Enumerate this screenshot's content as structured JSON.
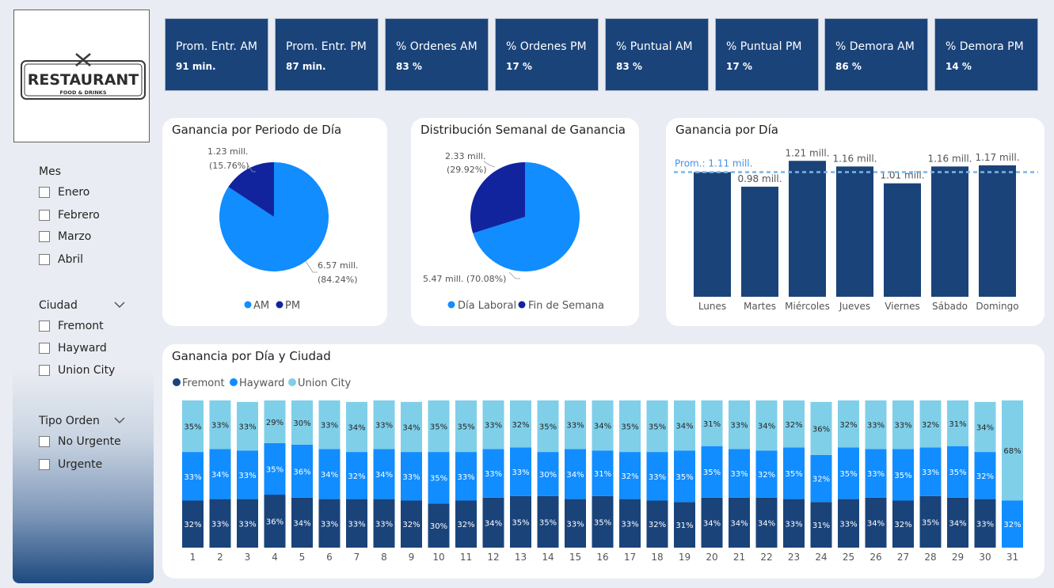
{
  "logo": {
    "name": "RESTAURANT",
    "tagline": "FOOD & DRINKS"
  },
  "slicers": {
    "mes": {
      "title": "Mes",
      "items": [
        "Enero",
        "Febrero",
        "Marzo",
        "Abril"
      ]
    },
    "ciudad": {
      "title": "Ciudad",
      "items": [
        "Fremont",
        "Hayward",
        "Union City"
      ]
    },
    "tipo": {
      "title": "Tipo Orden",
      "items": [
        "No Urgente",
        "Urgente"
      ]
    }
  },
  "kpis": [
    {
      "label": "Prom. Entr. AM",
      "value": "91 min."
    },
    {
      "label": "Prom. Entr. PM",
      "value": "87 min."
    },
    {
      "label": "% Ordenes AM",
      "value": "83 %"
    },
    {
      "label": "% Ordenes PM",
      "value": "17 %"
    },
    {
      "label": "% Puntual AM",
      "value": "83 %"
    },
    {
      "label": "% Puntual PM",
      "value": "17 %"
    },
    {
      "label": "% Demora AM",
      "value": "86 %"
    },
    {
      "label": "% Demora PM",
      "value": "14 %"
    }
  ],
  "colors": {
    "navy": "#1a437a",
    "blue": "#118dff",
    "light": "#7fcfe9",
    "dark_pie": "#12239e",
    "avg_line": "#7ab6e6"
  },
  "chart_data": [
    {
      "type": "pie",
      "title": "Ganancia por Periodo de Día",
      "labels": [
        "AM",
        "PM"
      ],
      "values": [
        6.57,
        1.23
      ],
      "percents": [
        84.24,
        15.76
      ],
      "value_labels": [
        "6.57 mill.",
        "1.23 mill."
      ],
      "percent_labels": [
        "(84.24%)",
        "(15.76%)"
      ],
      "colors": [
        "#118dff",
        "#12239e"
      ]
    },
    {
      "type": "pie",
      "title": "Distribución Semanal de Ganancia",
      "labels": [
        "Día Laboral",
        "Fin de Semana"
      ],
      "values": [
        5.47,
        2.33
      ],
      "percents": [
        70.08,
        29.92
      ],
      "value_labels": [
        "5.47 mill. (70.08%)",
        "2.33 mill."
      ],
      "percent_labels": [
        "",
        "(29.92%)"
      ],
      "colors": [
        "#118dff",
        "#12239e"
      ]
    },
    {
      "type": "bar",
      "title": "Ganancia por Día",
      "categories": [
        "Lunes",
        "Martes",
        "Miércoles",
        "Jueves",
        "Viernes",
        "Sábado",
        "Domingo"
      ],
      "values": [
        1.11,
        0.98,
        1.21,
        1.16,
        1.01,
        1.16,
        1.17
      ],
      "value_labels": [
        "",
        "0.98 mill.",
        "1.21 mill.",
        "1.16 mill.",
        "1.01 mill.",
        "1.16 mill.",
        "1.17 mill."
      ],
      "average": 1.11,
      "average_label": "Prom.: 1.11 mill.",
      "ylim": [
        0,
        1.24
      ]
    },
    {
      "type": "bar",
      "stacked": "percent",
      "title": "Ganancia por Día y Ciudad",
      "categories": [
        "1",
        "2",
        "3",
        "4",
        "5",
        "6",
        "7",
        "8",
        "9",
        "10",
        "11",
        "12",
        "13",
        "14",
        "15",
        "16",
        "17",
        "18",
        "19",
        "20",
        "21",
        "22",
        "23",
        "24",
        "25",
        "26",
        "27",
        "28",
        "29",
        "30",
        "31"
      ],
      "series": [
        {
          "name": "Fremont",
          "color": "#1a437a",
          "values": [
            32,
            33,
            33,
            36,
            34,
            33,
            33,
            33,
            32,
            30,
            32,
            34,
            35,
            35,
            33,
            35,
            33,
            32,
            31,
            34,
            34,
            34,
            33,
            31,
            33,
            34,
            32,
            35,
            34,
            33,
            0
          ]
        },
        {
          "name": "Hayward",
          "color": "#118dff",
          "values": [
            33,
            34,
            33,
            35,
            36,
            34,
            32,
            34,
            33,
            35,
            33,
            33,
            33,
            30,
            34,
            31,
            32,
            33,
            35,
            35,
            33,
            32,
            35,
            32,
            35,
            33,
            35,
            33,
            35,
            32,
            32
          ]
        },
        {
          "name": "Union City",
          "color": "#7fcfe9",
          "values": [
            35,
            33,
            33,
            29,
            30,
            33,
            34,
            33,
            34,
            35,
            35,
            33,
            32,
            35,
            33,
            34,
            35,
            35,
            34,
            31,
            33,
            34,
            32,
            36,
            32,
            33,
            33,
            32,
            31,
            34,
            68
          ]
        }
      ]
    }
  ]
}
